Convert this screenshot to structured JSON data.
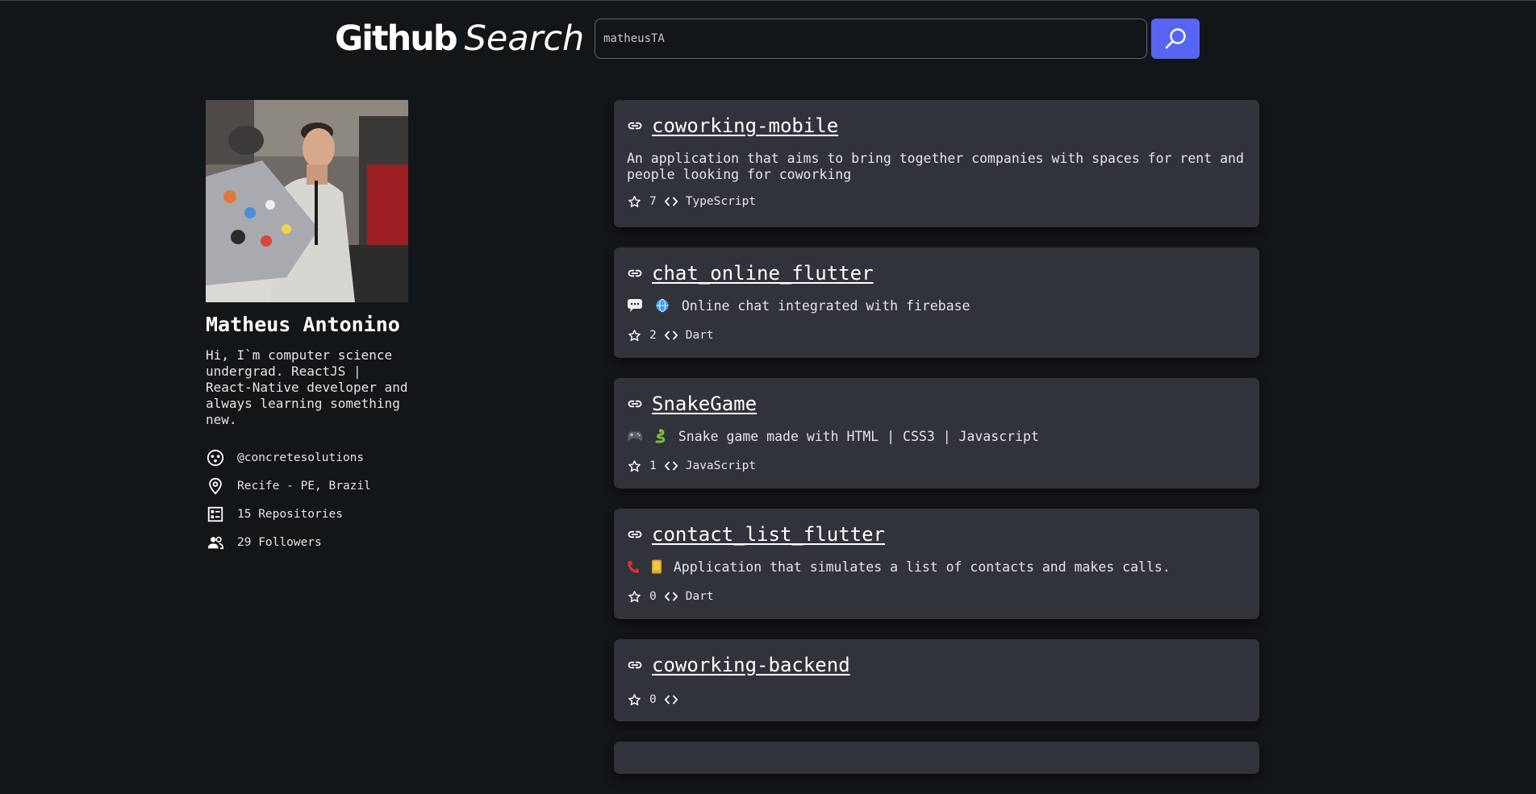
{
  "header": {
    "logo_bold": "Github",
    "logo_italic": "Search",
    "search": {
      "value": "matheusTA",
      "placeholder": ""
    },
    "search_button_icon": "magnifier-icon"
  },
  "profile": {
    "name": "Matheus Antonino",
    "bio": "Hi, I`m computer science undergrad. ReactJS | React-Native developer and always learning something new.",
    "company": "@concretesolutions",
    "location": "Recife - PE, Brazil",
    "repositories": "15 Repositories",
    "followers": "29 Followers",
    "icons": {
      "company": "company-icon",
      "location": "location-pin-icon",
      "repositories": "repository-list-icon",
      "followers": "people-icon"
    }
  },
  "repos": [
    {
      "name": "coworking-mobile",
      "description": "An application that aims to bring together companies with spaces for rent and people looking for coworking",
      "stars": "7",
      "language": "TypeScript"
    },
    {
      "name": "chat_online_flutter",
      "description": "Online chat integrated with firebase",
      "stars": "2",
      "language": "Dart"
    },
    {
      "name": "SnakeGame",
      "description": "Snake game made with HTML | CSS3 | Javascript",
      "stars": "1",
      "language": "JavaScript"
    },
    {
      "name": "contact_list_flutter",
      "description": "Application that simulates a list of contacts and makes calls.",
      "stars": "0",
      "language": "Dart"
    },
    {
      "name": "coworking-backend",
      "description": "",
      "stars": "0",
      "language": ""
    }
  ],
  "colors": {
    "background": "#131619",
    "card": "#30333a",
    "accent": "#5865f2"
  }
}
